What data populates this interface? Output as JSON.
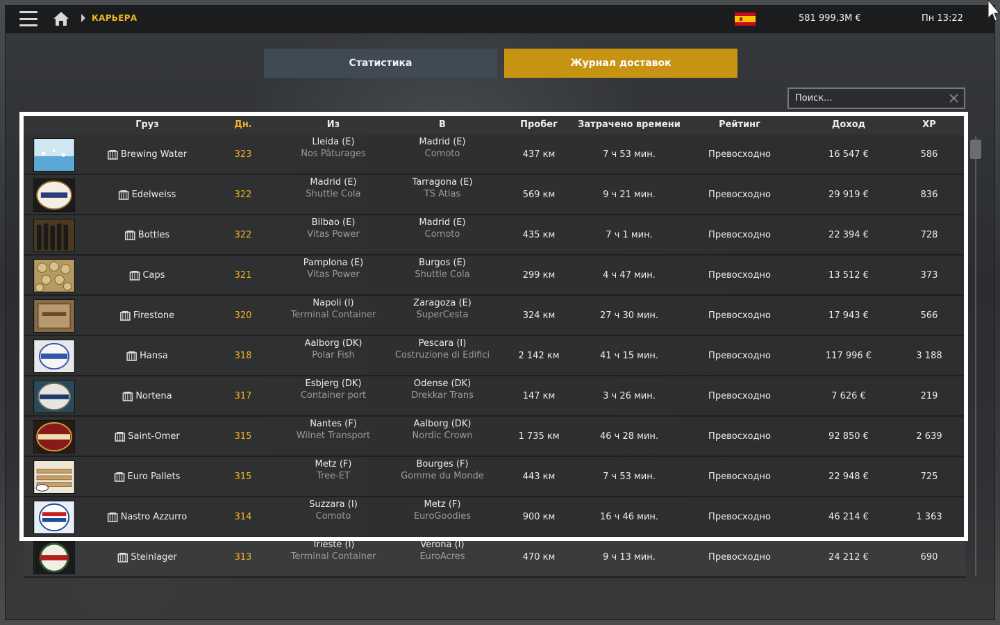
{
  "topbar": {
    "breadcrumb": "КАРЬЕРА",
    "money": "581 999,3M €",
    "clock": "Пн 13:22",
    "flag_icon": "spain-flag-icon"
  },
  "tabs": {
    "stats": "Статистика",
    "log": "Журнал доставок"
  },
  "search": {
    "placeholder": "Поиск..."
  },
  "table": {
    "headers": {
      "cargo": "Груз",
      "days": "Дн.",
      "from": "Из",
      "to": "В",
      "distance": "Пробег",
      "time": "Затрачено времени",
      "rating": "Рейтинг",
      "income": "Доход",
      "xp": "XP"
    },
    "rows": [
      {
        "cargo": "Brewing Water",
        "days": "323",
        "from_city": "Lleida (E)",
        "from_company": "Nos Pâturages",
        "to_city": "Madrid (E)",
        "to_company": "Comoto",
        "distance": "437 км",
        "time": "7 ч 53 мин.",
        "rating": "Превосходно",
        "income": "16 547 €",
        "xp": "586"
      },
      {
        "cargo": "Edelweiss",
        "days": "322",
        "from_city": "Madrid (E)",
        "from_company": "Shuttle Cola",
        "to_city": "Tarragona (E)",
        "to_company": "TS Atlas",
        "distance": "569 км",
        "time": "9 ч 21 мин.",
        "rating": "Превосходно",
        "income": "29 919 €",
        "xp": "836"
      },
      {
        "cargo": "Bottles",
        "days": "322",
        "from_city": "Bilbao (E)",
        "from_company": "Vitas Power",
        "to_city": "Madrid (E)",
        "to_company": "Comoto",
        "distance": "435 км",
        "time": "7 ч 1 мин.",
        "rating": "Превосходно",
        "income": "22 394 €",
        "xp": "728"
      },
      {
        "cargo": "Caps",
        "days": "321",
        "from_city": "Pamplona (E)",
        "from_company": "Vitas Power",
        "to_city": "Burgos (E)",
        "to_company": "Shuttle Cola",
        "distance": "299 км",
        "time": "4 ч 47 мин.",
        "rating": "Превосходно",
        "income": "13 512 €",
        "xp": "373"
      },
      {
        "cargo": "Firestone",
        "days": "320",
        "from_city": "Napoli (I)",
        "from_company": "Terminal Container",
        "to_city": "Zaragoza (E)",
        "to_company": "SuperCesta",
        "distance": "324 км",
        "time": "27 ч 30 мин.",
        "rating": "Превосходно",
        "income": "17 943 €",
        "xp": "566"
      },
      {
        "cargo": "Hansa",
        "days": "318",
        "from_city": "Aalborg (DK)",
        "from_company": "Polar Fish",
        "to_city": "Pescara (I)",
        "to_company": "Costruzione di Edifici",
        "distance": "2 142 км",
        "time": "41 ч 15 мин.",
        "rating": "Превосходно",
        "income": "117 996 €",
        "xp": "3 188"
      },
      {
        "cargo": "Nortena",
        "days": "317",
        "from_city": "Esbjerg (DK)",
        "from_company": "Container port",
        "to_city": "Odense (DK)",
        "to_company": "Drekkar Trans",
        "distance": "147 км",
        "time": "3 ч 26 мин.",
        "rating": "Превосходно",
        "income": "7 626 €",
        "xp": "219"
      },
      {
        "cargo": "Saint-Omer",
        "days": "315",
        "from_city": "Nantes (F)",
        "from_company": "Wilnet Transport",
        "to_city": "Aalborg (DK)",
        "to_company": "Nordic Crown",
        "distance": "1 735 км",
        "time": "46 ч 28 мин.",
        "rating": "Превосходно",
        "income": "92 850 €",
        "xp": "2 639"
      },
      {
        "cargo": "Euro Pallets",
        "days": "315",
        "from_city": "Metz (F)",
        "from_company": "Tree-ET",
        "to_city": "Bourges (F)",
        "to_company": "Gomme du Monde",
        "distance": "443 км",
        "time": "7 ч 53 мин.",
        "rating": "Превосходно",
        "income": "22 948 €",
        "xp": "725"
      },
      {
        "cargo": "Nastro Azzurro",
        "days": "314",
        "from_city": "Suzzara (I)",
        "from_company": "Comoto",
        "to_city": "Metz (F)",
        "to_company": "EuroGoodies",
        "distance": "900 км",
        "time": "16 ч 46 мин.",
        "rating": "Превосходно",
        "income": "46 214 €",
        "xp": "1 363"
      },
      {
        "cargo": "Steinlager",
        "days": "313",
        "from_city": "Trieste (I)",
        "from_company": "Terminal Container",
        "to_city": "Verona (I)",
        "to_company": "EuroAcres",
        "distance": "470 км",
        "time": "9 ч 13 мин.",
        "rating": "Превосходно",
        "income": "24 212 €",
        "xp": "690"
      }
    ]
  },
  "colors": {
    "accent": "#f2b51d",
    "tab_active": "#c79313",
    "tab_inactive": "#3f4a54"
  }
}
